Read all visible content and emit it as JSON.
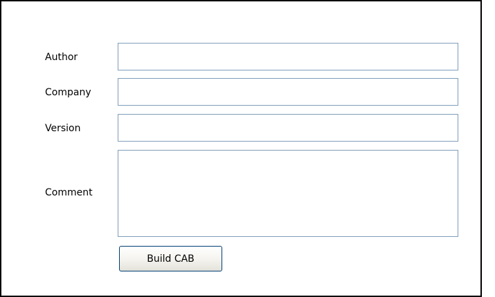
{
  "form": {
    "author": {
      "label": "Author",
      "value": ""
    },
    "company": {
      "label": "Company",
      "value": ""
    },
    "version": {
      "label": "Version",
      "value": ""
    },
    "comment": {
      "label": "Comment",
      "value": ""
    },
    "build_button_label": "Build CAB"
  }
}
